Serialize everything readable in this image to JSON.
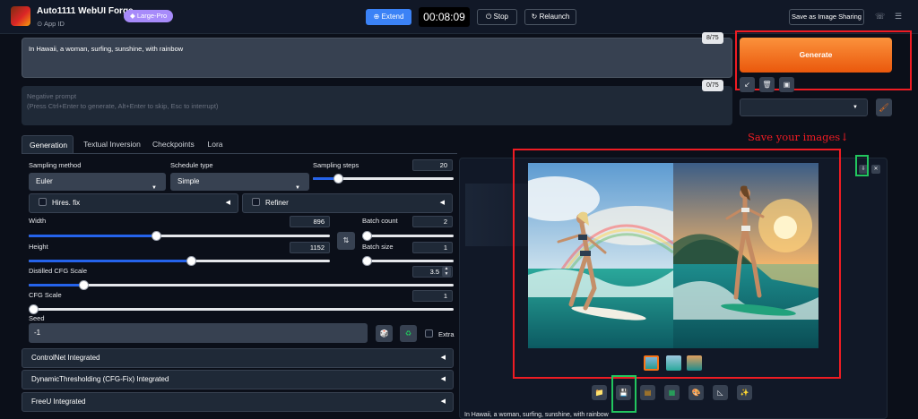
{
  "app": {
    "title": "Auto1111 WebUI Forge",
    "app_id_label": "App ID",
    "badge": "Large-Pro"
  },
  "header": {
    "extend_label": "Extend",
    "timer": "00:08:09",
    "stop_label": "Stop",
    "relaunch_label": "Relaunch",
    "save_sharing_label": "Save as Image Sharing"
  },
  "prompt": {
    "positive": "In Hawaii, a woman, surfing, sunshine, with rainbow",
    "positive_count": "8/75",
    "negative_placeholder_1": "Negative prompt",
    "negative_placeholder_2": "(Press Ctrl+Enter to generate, Alt+Enter to skip, Esc to interrupt)",
    "negative_count": "0/75"
  },
  "generate": {
    "label": "Generate",
    "tool_icons": [
      "arrow-icon",
      "trash-icon",
      "clipboard-icon"
    ]
  },
  "tabs": [
    "Generation",
    "Textual Inversion",
    "Checkpoints",
    "Lora"
  ],
  "generation": {
    "sampling_method_label": "Sampling method",
    "sampling_method_value": "Euler",
    "schedule_type_label": "Schedule type",
    "schedule_type_value": "Simple",
    "sampling_steps_label": "Sampling steps",
    "sampling_steps_value": "20",
    "hires_fix_label": "Hires. fix",
    "refiner_label": "Refiner",
    "width_label": "Width",
    "width_value": "896",
    "height_label": "Height",
    "height_value": "1152",
    "batch_count_label": "Batch count",
    "batch_count_value": "2",
    "batch_size_label": "Batch size",
    "batch_size_value": "1",
    "distilled_cfg_label": "Distilled CFG Scale",
    "distilled_cfg_value": "3.5",
    "cfg_label": "CFG Scale",
    "cfg_value": "1",
    "seed_label": "Seed",
    "seed_value": "-1",
    "extra_label": "Extra",
    "sliders": {
      "sampling_steps": 0.16,
      "width": 0.42,
      "height": 0.54,
      "batch_count": 0.0,
      "batch_size": 0.0,
      "distilled_cfg": 0.12,
      "cfg": 0.0
    }
  },
  "accordions": [
    "ControlNet Integrated",
    "DynamicThresholding (CFG-Fix) Integrated",
    "FreeU Integrated"
  ],
  "output": {
    "annotation": "Save your images↓",
    "caption": "In Hawaii, a woman, surfing, sunshine, with rainbow"
  },
  "colors": {
    "accent": "#ea580c",
    "extend": "#3b82f6",
    "highlight_red": "#ef1c23",
    "highlight_green": "#22c55e"
  }
}
